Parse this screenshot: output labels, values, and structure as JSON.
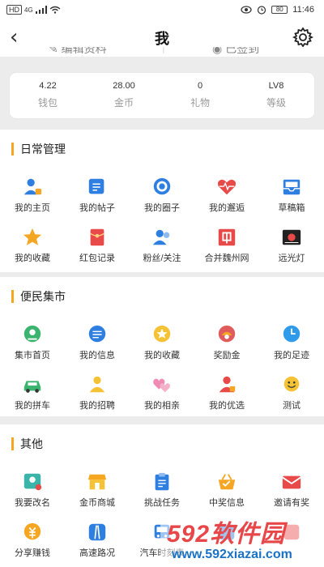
{
  "status": {
    "sig1": "HD",
    "sig2": "4G",
    "battery": "80",
    "time": "11:46"
  },
  "nav": {
    "title": "我"
  },
  "header_cut": {
    "left": "编辑资料",
    "right": "已签到"
  },
  "stats": [
    {
      "value": "4.22",
      "label": "钱包"
    },
    {
      "value": "28.00",
      "label": "金币"
    },
    {
      "value": "0",
      "label": "礼物"
    },
    {
      "value": "LV8",
      "label": "等级"
    }
  ],
  "sections": [
    {
      "title": "日常管理",
      "items": [
        {
          "label": "我的主页",
          "icon": "user-icon"
        },
        {
          "label": "我的帖子",
          "icon": "post-icon"
        },
        {
          "label": "我的圈子",
          "icon": "circle-icon"
        },
        {
          "label": "我的邂逅",
          "icon": "heart-pulse-icon"
        },
        {
          "label": "草稿箱",
          "icon": "inbox-icon"
        },
        {
          "label": "我的收藏",
          "icon": "star-icon"
        },
        {
          "label": "红包记录",
          "icon": "red-envelope-icon"
        },
        {
          "label": "粉丝/关注",
          "icon": "fans-icon"
        },
        {
          "label": "合并魏州网",
          "icon": "merge-icon"
        },
        {
          "label": "远光灯",
          "icon": "beam-light-icon"
        }
      ]
    },
    {
      "title": "便民集市",
      "items": [
        {
          "label": "集市首页",
          "icon": "market-home-icon"
        },
        {
          "label": "我的信息",
          "icon": "message-icon"
        },
        {
          "label": "我的收藏",
          "icon": "favorite-badge-icon"
        },
        {
          "label": "奖励金",
          "icon": "reward-icon"
        },
        {
          "label": "我的足迹",
          "icon": "clock-icon"
        },
        {
          "label": "我的拼车",
          "icon": "car-icon"
        },
        {
          "label": "我的招聘",
          "icon": "recruit-icon"
        },
        {
          "label": "我的相亲",
          "icon": "hearts-icon"
        },
        {
          "label": "我的优选",
          "icon": "select-icon"
        },
        {
          "label": "测试",
          "icon": "smile-icon"
        }
      ]
    },
    {
      "title": "其他",
      "items": [
        {
          "label": "我要改名",
          "icon": "rename-icon"
        },
        {
          "label": "金币商城",
          "icon": "shop-icon"
        },
        {
          "label": "挑战任务",
          "icon": "task-icon"
        },
        {
          "label": "中奖信息",
          "icon": "prize-basket-icon"
        },
        {
          "label": "邀请有奖",
          "icon": "invite-mail-icon"
        },
        {
          "label": "分享赚钱",
          "icon": "share-money-icon"
        },
        {
          "label": "高速路况",
          "icon": "road-icon"
        },
        {
          "label": "汽车时刻表",
          "icon": "bus-schedule-icon"
        },
        {
          "label": "",
          "icon": "blue-icon"
        },
        {
          "label": "",
          "icon": "red-icon"
        }
      ]
    }
  ],
  "watermark": {
    "big": "592软件园",
    "small": "www.592xiazai.com"
  },
  "colors": {
    "accent": "#f5a623",
    "blue": "#2f7fe0",
    "red": "#e84a4a"
  }
}
